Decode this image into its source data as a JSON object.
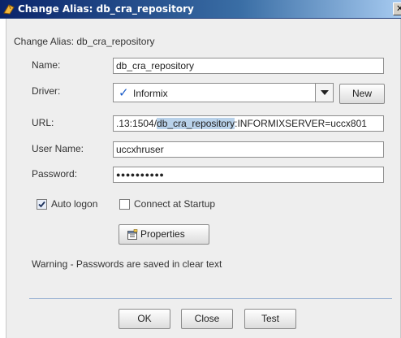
{
  "window": {
    "title": "Change Alias: db_cra_repository",
    "close_glyph": "✕"
  },
  "dialog": {
    "heading": "Change Alias: db_cra_repository",
    "name": {
      "label": "Name:",
      "value": "db_cra_repository"
    },
    "driver": {
      "label": "Driver:",
      "selected": "Informix",
      "check_icon": "checkmark-icon",
      "new_button": "New"
    },
    "url": {
      "label": "URL:",
      "value_pre": ".13:1504/",
      "value_sel": "db_cra_repository",
      "value_post": ":INFORMIXSERVER=uccx801"
    },
    "username": {
      "label": "User Name:",
      "value": "uccxhruser"
    },
    "password": {
      "label": "Password:",
      "value": "●●●●●●●●●●"
    },
    "auto_logon": {
      "label": "Auto logon",
      "checked": true
    },
    "connect_startup": {
      "label": "Connect at Startup",
      "checked": false
    },
    "properties_button": "Properties",
    "warning": "Warning - Passwords are saved in clear text",
    "buttons": {
      "ok": "OK",
      "close": "Close",
      "test": "Test"
    }
  }
}
